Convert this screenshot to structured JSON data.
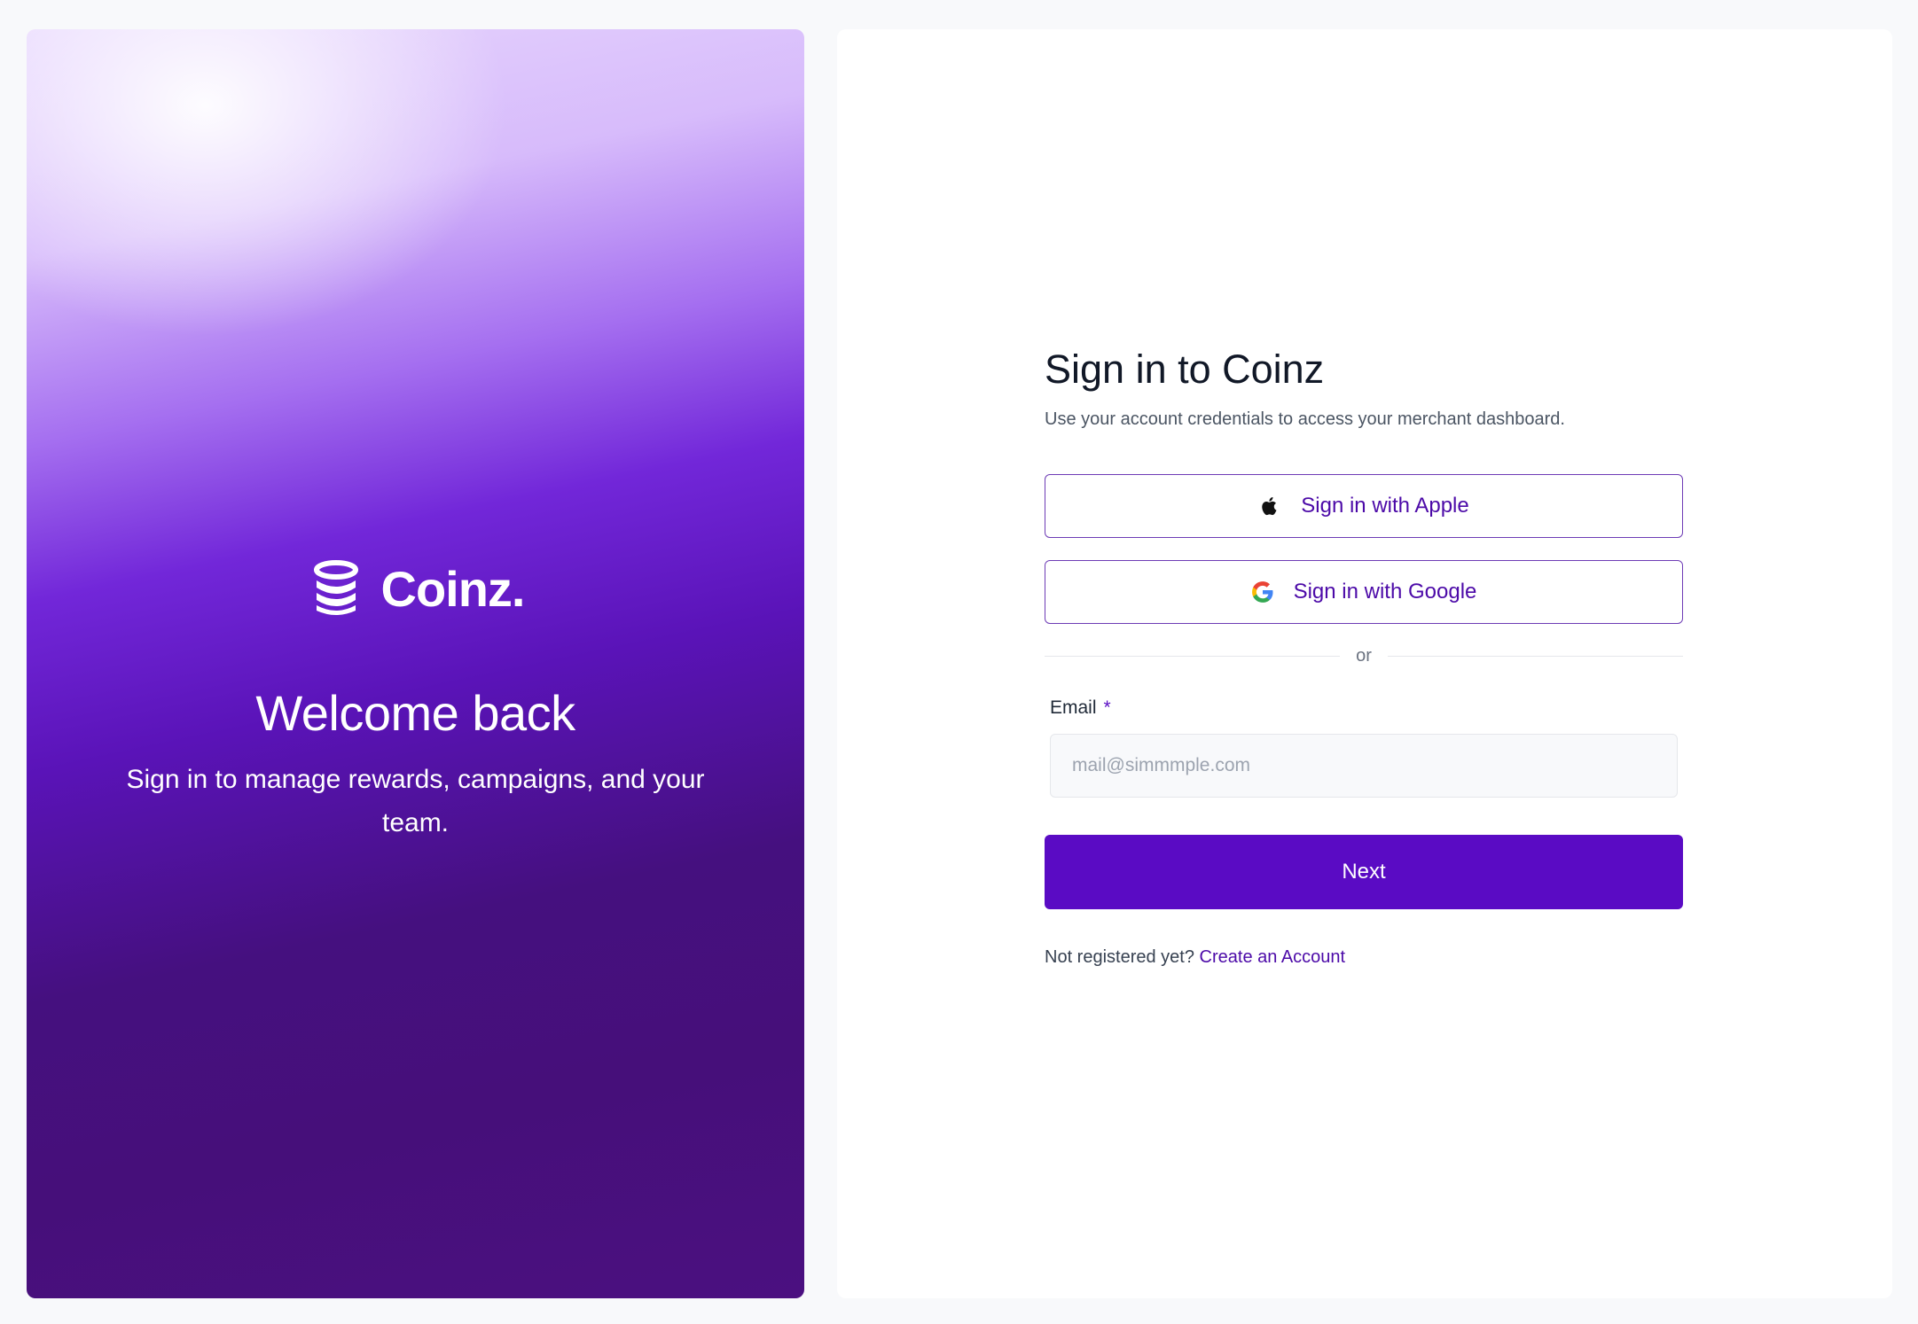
{
  "hero": {
    "brand": "Coinz.",
    "title": "Welcome back",
    "subtitle": "Sign in to manage rewards, campaigns, and your team."
  },
  "form": {
    "title": "Sign in to Coinz",
    "subtitle": "Use your account credentials to access your merchant dashboard.",
    "apple_label": "Sign in with Apple",
    "google_label": "Sign in with Google",
    "divider": "or",
    "email_label": "Email",
    "required_marker": "*",
    "email_placeholder": "mail@simmmple.com",
    "email_value": "",
    "next_label": "Next",
    "register_prompt": "Not registered yet?",
    "register_link": "Create an Account"
  },
  "icons": {
    "logo": "coin-stack-icon",
    "apple": "apple-icon",
    "google": "google-icon"
  },
  "colors": {
    "primary": "#5a0bc4",
    "link": "#4c0aa8",
    "hero_top": "#e7d6fd",
    "hero_bottom": "#460f7a"
  }
}
